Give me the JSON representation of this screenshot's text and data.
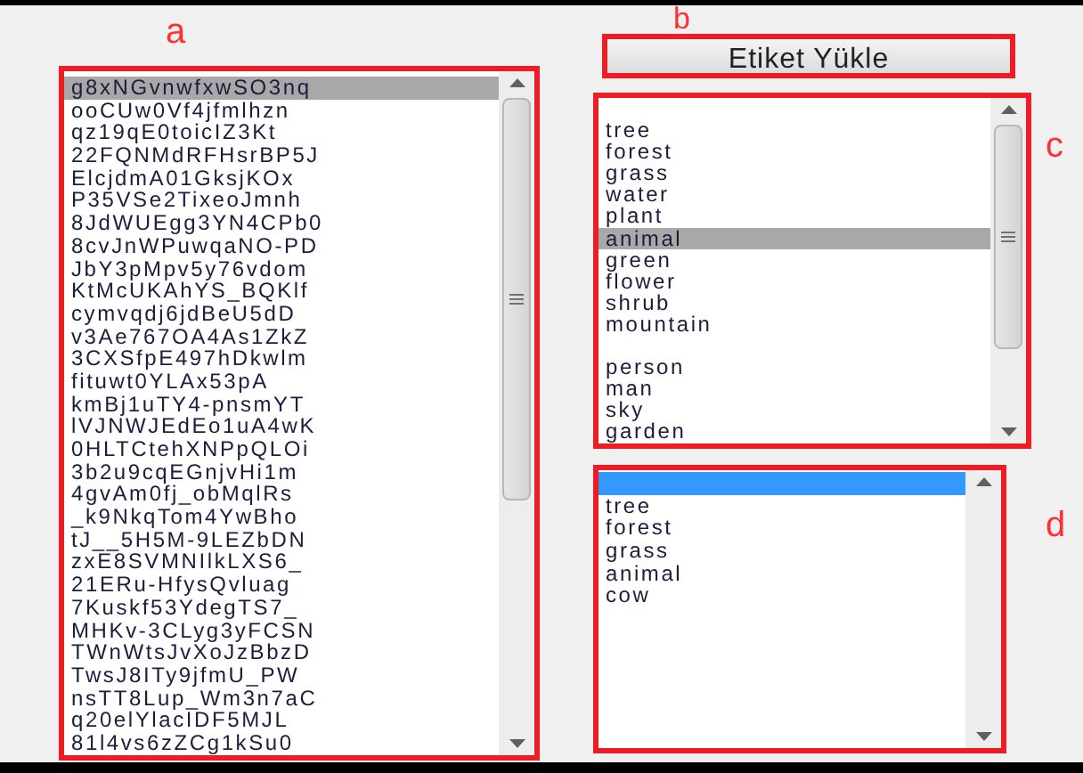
{
  "annotations": {
    "a": "a",
    "b": "b",
    "c": "c",
    "d": "d"
  },
  "names_list": {
    "items": [
      {
        "label": "g8xNGvnwfxwSO3nq",
        "selected": true
      },
      {
        "label": "ooCUw0Vf4jfmlhzn",
        "selected": false
      },
      {
        "label": "qz19qE0toicIZ3Kt",
        "selected": false
      },
      {
        "label": "22FQNMdRFHsrBP5J",
        "selected": false
      },
      {
        "label": "ElcjdmA01GksjKOx",
        "selected": false
      },
      {
        "label": "P35VSe2TixeoJmnh",
        "selected": false
      },
      {
        "label": "8JdWUEgg3YN4CPb0",
        "selected": false
      },
      {
        "label": "8cvJnWPuwqaNO-PD",
        "selected": false
      },
      {
        "label": "JbY3pMpv5y76vdom",
        "selected": false
      },
      {
        "label": "KtMcUKAhYS_BQKlf",
        "selected": false
      },
      {
        "label": "cymvqdj6jdBeU5dD",
        "selected": false
      },
      {
        "label": "v3Ae767OA4As1ZkZ",
        "selected": false
      },
      {
        "label": "3CXSfpE497hDkwlm",
        "selected": false
      },
      {
        "label": "fituwt0YLAx53pA",
        "selected": false
      },
      {
        "label": "kmBj1uTY4-pnsmYT",
        "selected": false
      },
      {
        "label": "lVJNWJEdEo1uA4wK",
        "selected": false
      },
      {
        "label": "0HLTCtehXNPpQLOi",
        "selected": false
      },
      {
        "label": "3b2u9cqEGnjvHi1m",
        "selected": false
      },
      {
        "label": "4gvAm0fj_obMqlRs",
        "selected": false
      },
      {
        "label": "_k9NkqTom4YwBho",
        "selected": false
      },
      {
        "label": "tJ__5H5M-9LEZbDN",
        "selected": false
      },
      {
        "label": "zxE8SVMNIlkLXS6_",
        "selected": false
      },
      {
        "label": "21ERu-HfysQvluag",
        "selected": false
      },
      {
        "label": "7Kuskf53YdegTS7_",
        "selected": false
      },
      {
        "label": "MHKv-3CLyg3yFCSN",
        "selected": false
      },
      {
        "label": "TWnWtsJvXoJzBbzD",
        "selected": false
      },
      {
        "label": "TwsJ8ITy9jfmU_PW",
        "selected": false
      },
      {
        "label": "nsTT8Lup_Wm3n7aC",
        "selected": false
      },
      {
        "label": "q20elYlacIDF5MJL",
        "selected": false
      },
      {
        "label": "81l4vs6zZCg1kSu0",
        "selected": false
      }
    ]
  },
  "load_button": {
    "label": "Etiket Yükle"
  },
  "tags_list": {
    "items": [
      {
        "selected": false
      },
      {
        "label": "tree",
        "selected": false
      },
      {
        "label": "forest",
        "selected": false
      },
      {
        "label": "grass",
        "selected": false
      },
      {
        "label": "water",
        "selected": false
      },
      {
        "label": "plant",
        "selected": false
      },
      {
        "label": "animal",
        "selected": true
      },
      {
        "label": "green",
        "selected": false
      },
      {
        "label": "flower",
        "selected": false
      },
      {
        "label": "shrub",
        "selected": false
      },
      {
        "label": "mountain",
        "selected": false
      },
      {
        "selected": false
      },
      {
        "label": "person",
        "selected": false
      },
      {
        "label": "man",
        "selected": false
      },
      {
        "label": "sky",
        "selected": false
      },
      {
        "label": "garden",
        "selected": false
      }
    ]
  },
  "result_list": {
    "items": [
      {
        "selected": true
      },
      {
        "label": "tree",
        "selected": false
      },
      {
        "label": "forest",
        "selected": false
      },
      {
        "label": "grass",
        "selected": false
      },
      {
        "label": "animal",
        "selected": false
      },
      {
        "label": "cow",
        "selected": false
      }
    ]
  }
}
